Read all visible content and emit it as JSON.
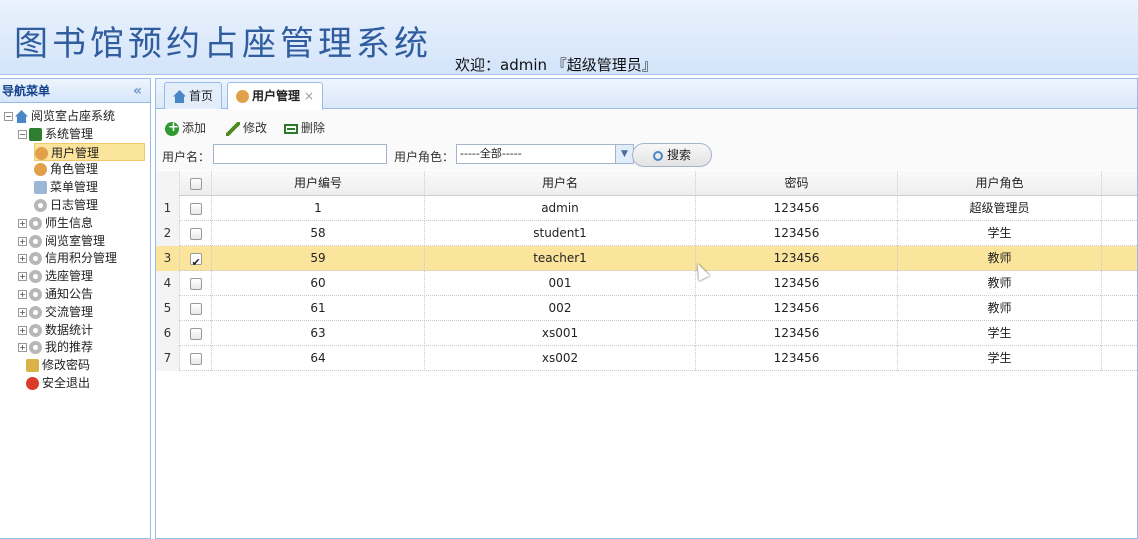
{
  "header": {
    "app_title": "图书馆预约占座管理系统",
    "welcome": "欢迎：admin 『超级管理员』"
  },
  "sidebar": {
    "title": "导航菜单",
    "collapse_glyph": "«",
    "tree": [
      {
        "label": "阅览室占座系统",
        "icon": "home-icon",
        "expander": "−"
      },
      {
        "label": "系统管理",
        "icon": "book-icon",
        "expander": "−"
      },
      {
        "label": "用户管理",
        "icon": "user-icon",
        "selected": true
      },
      {
        "label": "角色管理",
        "icon": "user-group-icon"
      },
      {
        "label": "菜单管理",
        "icon": "menu-icon"
      },
      {
        "label": "日志管理",
        "icon": "gear-icon"
      },
      {
        "label": "师生信息",
        "icon": "gear-icon",
        "expander": "+"
      },
      {
        "label": "阅览室管理",
        "icon": "gear-icon",
        "expander": "+"
      },
      {
        "label": "信用积分管理",
        "icon": "gear-icon",
        "expander": "+"
      },
      {
        "label": "选座管理",
        "icon": "gear-icon",
        "expander": "+"
      },
      {
        "label": "通知公告",
        "icon": "gear-icon",
        "expander": "+"
      },
      {
        "label": "交流管理",
        "icon": "gear-icon",
        "expander": "+"
      },
      {
        "label": "数据统计",
        "icon": "gear-icon",
        "expander": "+"
      },
      {
        "label": "我的推荐",
        "icon": "gear-icon",
        "expander": "+"
      },
      {
        "label": "修改密码",
        "icon": "key-icon"
      },
      {
        "label": "安全退出",
        "icon": "exit-icon"
      }
    ]
  },
  "tabs": [
    {
      "label": "首页",
      "icon": "home-icon"
    },
    {
      "label": "用户管理",
      "icon": "user-icon",
      "close": "×",
      "active": true
    }
  ],
  "toolbar": {
    "add": "添加",
    "edit": "修改",
    "delete": "删除"
  },
  "search": {
    "username_label": "用户名：",
    "username_value": "",
    "role_label": "用户角色：",
    "role_value": "-----全部-----",
    "button": "搜索"
  },
  "grid": {
    "columns": [
      "用户编号",
      "用户名",
      "密码",
      "用户角色"
    ],
    "rows": [
      {
        "n": "1",
        "id": "1",
        "name": "admin",
        "pwd": "123456",
        "role": "超级管理员",
        "checked": false
      },
      {
        "n": "2",
        "id": "58",
        "name": "student1",
        "pwd": "123456",
        "role": "学生",
        "checked": false
      },
      {
        "n": "3",
        "id": "59",
        "name": "teacher1",
        "pwd": "123456",
        "role": "教师",
        "checked": true
      },
      {
        "n": "4",
        "id": "60",
        "name": "001",
        "pwd": "123456",
        "role": "教师",
        "checked": false
      },
      {
        "n": "5",
        "id": "61",
        "name": "002",
        "pwd": "123456",
        "role": "教师",
        "checked": false
      },
      {
        "n": "6",
        "id": "63",
        "name": "xs001",
        "pwd": "123456",
        "role": "学生",
        "checked": false
      },
      {
        "n": "7",
        "id": "64",
        "name": "xs002",
        "pwd": "123456",
        "role": "学生",
        "checked": false
      }
    ]
  }
}
